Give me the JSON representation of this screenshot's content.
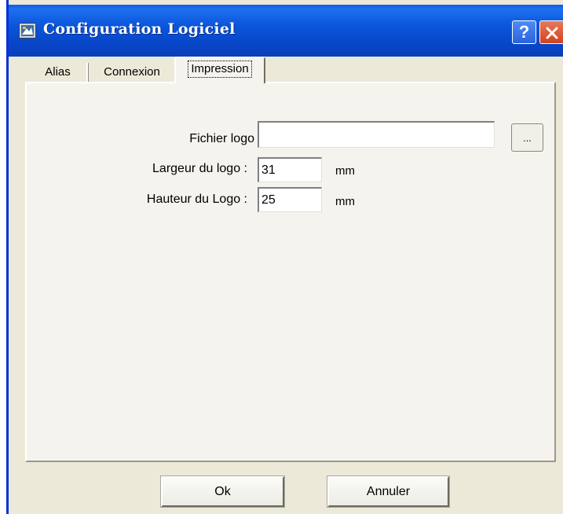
{
  "window": {
    "title": "Configuration Logiciel",
    "help_label": "?"
  },
  "tabs": [
    {
      "label": "Alias",
      "active": false
    },
    {
      "label": "Connexion",
      "active": false
    },
    {
      "label": "Impression",
      "active": true
    }
  ],
  "impression": {
    "logo_file": {
      "label": "Fichier logo",
      "value": "",
      "browse_label": "..."
    },
    "logo_width": {
      "label": "Largeur du logo :",
      "value": "31",
      "unit": "mm"
    },
    "logo_height": {
      "label": "Hauteur du Logo :",
      "value": "25",
      "unit": "mm"
    }
  },
  "buttons": {
    "ok_label": "Ok",
    "cancel_label": "Annuler"
  },
  "colors": {
    "titlebar": "#0a52d6",
    "dialog_background": "#ece9d8",
    "panel_background": "#f4f3ee",
    "close_button": "#d2411f"
  }
}
